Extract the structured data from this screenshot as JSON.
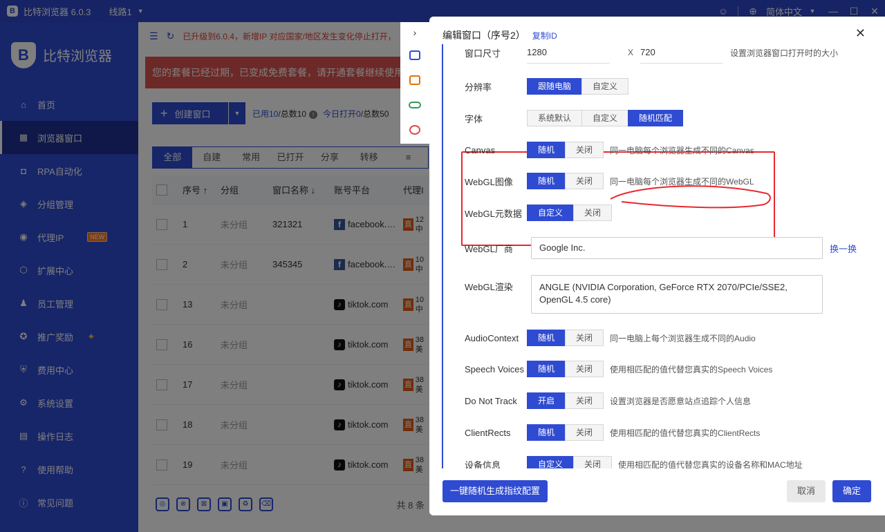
{
  "titlebar": {
    "app_title": "比特浏览器 6.0.3",
    "route": "线路1",
    "language": "简体中文",
    "logo_letter": "B"
  },
  "sidebar": {
    "brand": "比特浏览器",
    "brand_letter": "B",
    "items": [
      {
        "label": "首页",
        "icon": "home-icon",
        "glyph": "⌂"
      },
      {
        "label": "浏览器窗口",
        "icon": "grid-icon",
        "glyph": "▦"
      },
      {
        "label": "RPA自动化",
        "icon": "robot-icon",
        "glyph": "◘"
      },
      {
        "label": "分组管理",
        "icon": "folder-icon",
        "glyph": "◈"
      },
      {
        "label": "代理IP",
        "icon": "location-pin-icon",
        "glyph": "◉"
      },
      {
        "label": "扩展中心",
        "icon": "cube-icon",
        "glyph": "⬡"
      },
      {
        "label": "员工管理",
        "icon": "users-icon",
        "glyph": "♟"
      },
      {
        "label": "推广奖励",
        "icon": "gift-icon",
        "glyph": "✪"
      },
      {
        "label": "费用中心",
        "icon": "shield-icon",
        "glyph": "⛨"
      },
      {
        "label": "系统设置",
        "icon": "gear-icon",
        "glyph": "⚙"
      },
      {
        "label": "操作日志",
        "icon": "log-icon",
        "glyph": "▤"
      },
      {
        "label": "使用帮助",
        "icon": "help-icon",
        "glyph": "?"
      },
      {
        "label": "常见问题",
        "icon": "info-icon",
        "glyph": "ⓘ"
      }
    ],
    "new_badge": "NEW"
  },
  "main": {
    "notice": "已升级到6.0.4，新增IP 对应国家/地区发生变化停止打开，",
    "expired": "您的套餐已经过期，已变成免费套餐，请开通套餐继续使用",
    "create_label": "创建窗口",
    "used_label": "已用10",
    "total_label": "/总数10",
    "today_label": "今日打开0",
    "today_total": "/总数50",
    "tabs": [
      "全部",
      "自建",
      "常用",
      "已打开",
      "分享",
      "转移",
      "≡"
    ],
    "columns": [
      "序号 ↑",
      "分组",
      "窗口名称 ↓",
      "账号平台",
      "代理IP"
    ],
    "rows": [
      {
        "no": "1",
        "group": "未分组",
        "name": "321321",
        "platform": "facebook.…",
        "platform_icon": "facebook-icon",
        "glyph": "f",
        "proxy": "12",
        "proxy2": "中"
      },
      {
        "no": "2",
        "group": "未分组",
        "name": "345345",
        "platform": "facebook.…",
        "platform_icon": "facebook-icon",
        "glyph": "f",
        "proxy": "10",
        "proxy2": "中"
      },
      {
        "no": "13",
        "group": "未分组",
        "name": "",
        "platform": "tiktok.com",
        "platform_icon": "tiktok-icon",
        "glyph": "♪",
        "proxy": "10",
        "proxy2": "中"
      },
      {
        "no": "16",
        "group": "未分组",
        "name": "",
        "platform": "tiktok.com",
        "platform_icon": "tiktok-icon",
        "glyph": "♪",
        "proxy": "38",
        "proxy2": "美"
      },
      {
        "no": "17",
        "group": "未分组",
        "name": "",
        "platform": "tiktok.com",
        "platform_icon": "tiktok-icon",
        "glyph": "♪",
        "proxy": "38",
        "proxy2": "美"
      },
      {
        "no": "18",
        "group": "未分组",
        "name": "",
        "platform": "tiktok.com",
        "platform_icon": "tiktok-icon",
        "glyph": "♪",
        "proxy": "38",
        "proxy2": "美"
      },
      {
        "no": "19",
        "group": "未分组",
        "name": "",
        "platform": "tiktok.com",
        "platform_icon": "tiktok-icon",
        "glyph": "♪",
        "proxy": "38",
        "proxy2": "美"
      }
    ],
    "proxy_badge": "直",
    "total_count": "共 8 条"
  },
  "modal": {
    "title": "编辑窗口（序号2）",
    "copy_id": "复制ID",
    "window_size": {
      "label": "窗口尺寸",
      "width": "1280",
      "x": "X",
      "height": "720",
      "desc": "设置浏览器窗口打开时的大小"
    },
    "resolution": {
      "label": "分辨率",
      "options": [
        "跟随电脑",
        "自定义"
      ]
    },
    "font": {
      "label": "字体",
      "options": [
        "系统默认",
        "自定义",
        "随机匹配"
      ]
    },
    "canvas": {
      "label": "Canvas",
      "options": [
        "随机",
        "关闭"
      ],
      "desc": "同一电脑每个浏览器生成不同的Canvas"
    },
    "webgl_image": {
      "label": "WebGL图像",
      "options": [
        "随机",
        "关闭"
      ],
      "desc": "同一电脑每个浏览器生成不同的WebGL"
    },
    "webgl_meta": {
      "label": "WebGL元数据",
      "options": [
        "自定义",
        "关闭"
      ]
    },
    "webgl_vendor": {
      "label": "WebGL厂商",
      "value": "Google Inc.",
      "change": "换一换"
    },
    "webgl_render": {
      "label": "WebGL渲染",
      "value": "ANGLE (NVIDIA Corporation, GeForce RTX 2070/PCIe/SSE2, OpenGL 4.5 core)"
    },
    "audio": {
      "label": "AudioContext",
      "options": [
        "随机",
        "关闭"
      ],
      "desc": "同一电脑上每个浏览器生成不同的Audio"
    },
    "speech": {
      "label": "Speech Voices",
      "options": [
        "随机",
        "关闭"
      ],
      "desc": "使用相匹配的值代替您真实的Speech Voices"
    },
    "dnt": {
      "label": "Do Not Track",
      "options": [
        "开启",
        "关闭"
      ],
      "desc": "设置浏览器是否愿意站点追踪个人信息"
    },
    "rects": {
      "label": "ClientRects",
      "options": [
        "随机",
        "关闭"
      ],
      "desc": "使用相匹配的值代替您真实的ClientRects"
    },
    "device": {
      "label": "设备信息",
      "options": [
        "自定义",
        "关闭"
      ],
      "desc": "使用相匹配的值代替您真实的设备名称和MAC地址"
    },
    "gen_button": "一键随机生成指纹配置",
    "cancel": "取消",
    "ok": "确定"
  },
  "colors": {
    "primary": "#2f4bd2",
    "highlight": "#e8272d",
    "danger_banner": "#d9534f"
  }
}
